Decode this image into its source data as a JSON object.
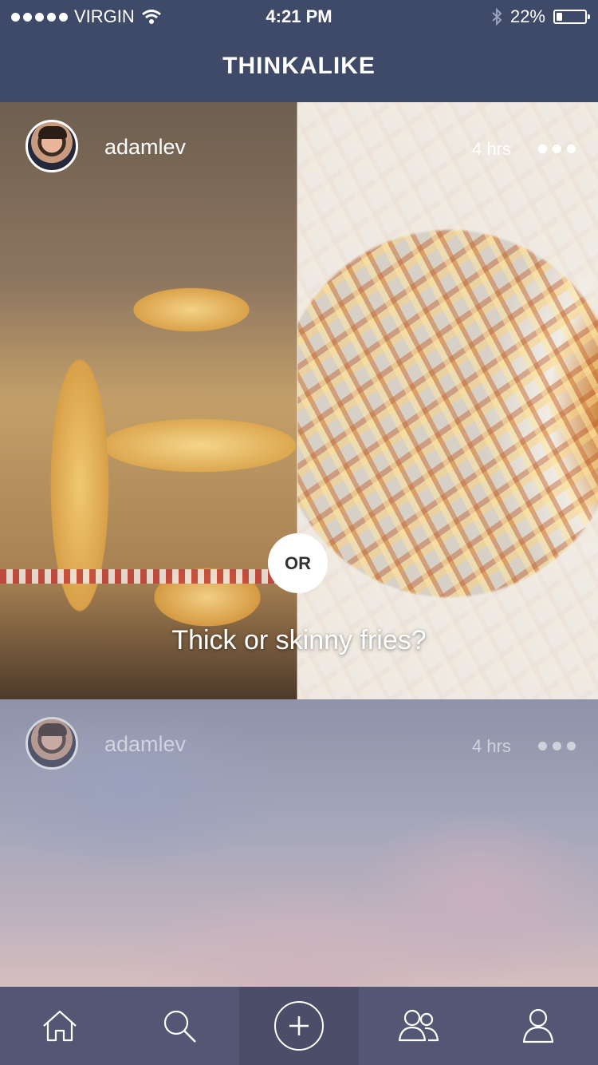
{
  "status_bar": {
    "carrier": "VIRGIN",
    "time": "4:21 PM",
    "battery": "22%",
    "battery_level": 0.22,
    "icons": [
      "signal-dots-icon",
      "wifi-icon",
      "bluetooth-icon",
      "battery-icon"
    ]
  },
  "nav": {
    "title": "THINKALIKE"
  },
  "posts": [
    {
      "username": "adamlev",
      "time": "4 hrs",
      "question": "Thick or skinny fries?",
      "or_label": "OR"
    },
    {
      "username": "adamlev",
      "time": "4 hrs"
    }
  ],
  "tabbar": {
    "items": [
      "home-icon",
      "search-icon",
      "add-icon",
      "friends-icon",
      "profile-icon"
    ]
  },
  "colors": {
    "nav_bg": "#3f4a68",
    "tabbar_bg": "#5c5c76",
    "text": "#ffffff"
  }
}
